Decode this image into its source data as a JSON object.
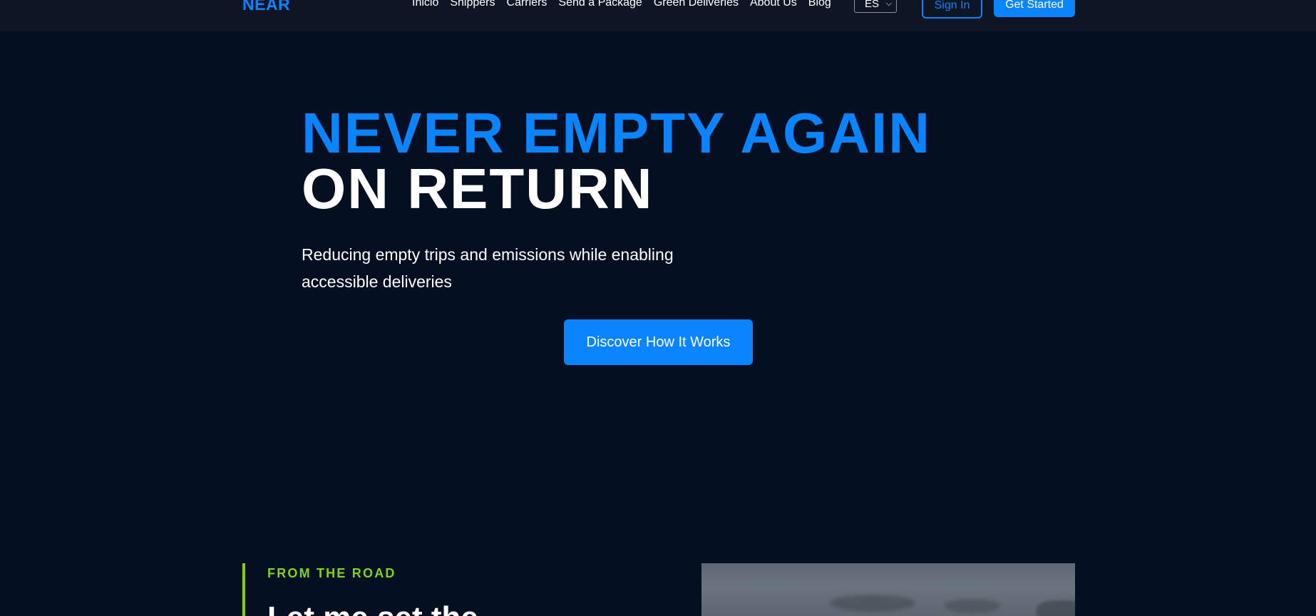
{
  "nav": {
    "logo": "NEAR",
    "links": [
      "Inicio",
      "Shippers",
      "Carriers",
      "Send a Package",
      "Green Deliveries",
      "About Us",
      "Blog"
    ],
    "language": "ES",
    "sign_in": "Sign In",
    "get_started": "Get Started"
  },
  "hero": {
    "title_line1": "NEVER EMPTY AGAIN",
    "title_line2": "ON RETURN",
    "subtitle": "Reducing empty trips and emissions while enabling accessible deliveries",
    "cta": "Discover How It Works"
  },
  "road": {
    "eyebrow": "FROM THE ROAD",
    "heading": "Let me set the"
  },
  "colors": {
    "background": "#050f22",
    "navbar": "#0e1625",
    "accent": "#0b84ff",
    "eyebrow": "#7ed321"
  }
}
